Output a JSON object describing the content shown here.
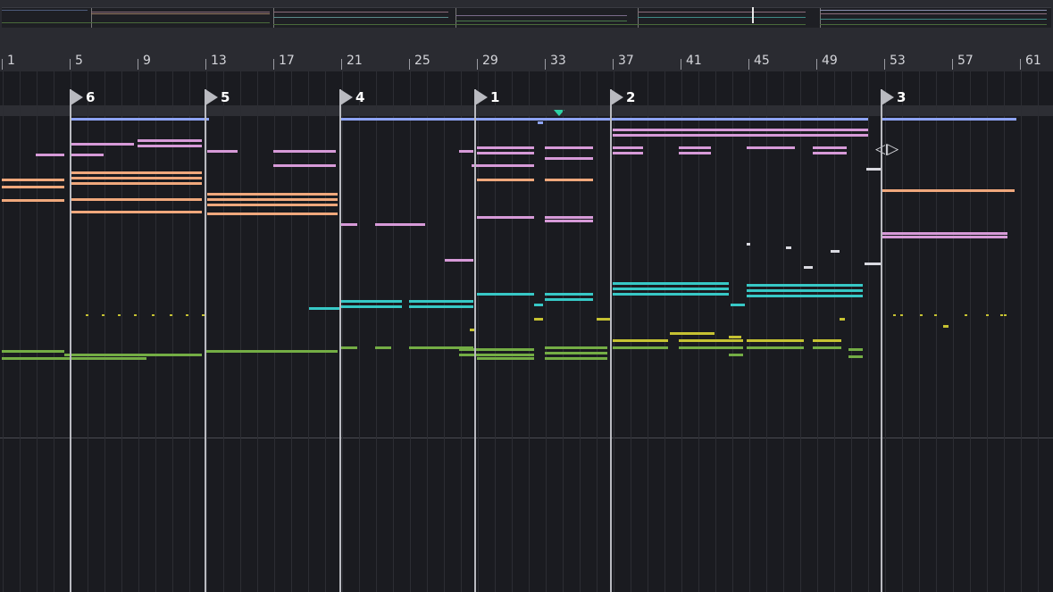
{
  "ruler": {
    "bar_numbers": [
      "1",
      "5",
      "9",
      "13",
      "17",
      "21",
      "25",
      "29",
      "33",
      "37",
      "41",
      "45",
      "49",
      "53",
      "57",
      "61"
    ]
  },
  "locators": [
    {
      "label": "6"
    },
    {
      "label": "5"
    },
    {
      "label": "4"
    },
    {
      "label": "1"
    },
    {
      "label": "2"
    },
    {
      "label": "3"
    }
  ],
  "icons": {
    "play_marker": "triangle-down-icon",
    "loop_brace": "loop-brace-icon",
    "locator_flag": "flag-icon"
  },
  "colors": {
    "lavender": "#8ea4f4",
    "pink": "#d79ad8",
    "peach": "#f0a87c",
    "cyan": "#37c8c6",
    "green": "#74ad45",
    "yellow": "#c6c232",
    "white": "#d9d9e0",
    "marker_accent": "#2ed1a5"
  }
}
